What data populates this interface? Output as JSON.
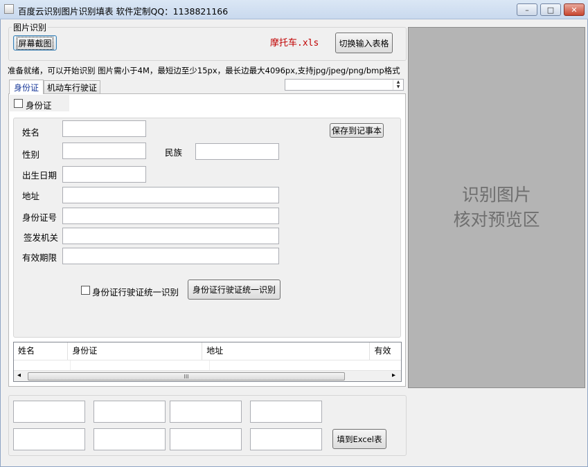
{
  "window": {
    "title": "百度云识别图片识别填表  软件定制QQ：1138821166",
    "minimize_glyph": "–",
    "maximize_glyph": "□",
    "close_glyph": "✕"
  },
  "image_group": {
    "legend": "图片识别",
    "screenshot_button": "屏幕截图",
    "filename": "摩托车.xls",
    "filename_color": "#c00000",
    "switch_button": "切换输入表格"
  },
  "status_text": "准备就绪，可以开始识别 图片需小于4M，最短边至少15px，最长边最大4096px,支持jpg/jpeg/png/bmp格式",
  "tabs": [
    {
      "label": "身份证",
      "active": true
    },
    {
      "label": "机动车行驶证",
      "active": false
    }
  ],
  "id_tab": {
    "id_checkbox_label": "身份证",
    "save_button": "保存到记事本",
    "fields": {
      "name": "姓名",
      "gender": "性别",
      "ethnicity": "民族",
      "birth": "出生日期",
      "address": "地址",
      "id_number": "身份证号",
      "issuer": "签发机关",
      "validity": "有效期限"
    },
    "unified_checkbox_label": "身份证行驶证统一识别",
    "unified_button": "身份证行驶证统一识别",
    "grid_columns": [
      "姓名",
      "身份证",
      "地址",
      "有效"
    ],
    "scroll_grip": "III",
    "scroll_left": "◂",
    "scroll_right": "▸"
  },
  "bottom": {
    "fill_excel_button": "填到Excel表"
  },
  "preview": {
    "line1": "识别图片",
    "line2": "核对预览区"
  },
  "icons": {
    "spin_up": "▲",
    "spin_down": "▼"
  }
}
